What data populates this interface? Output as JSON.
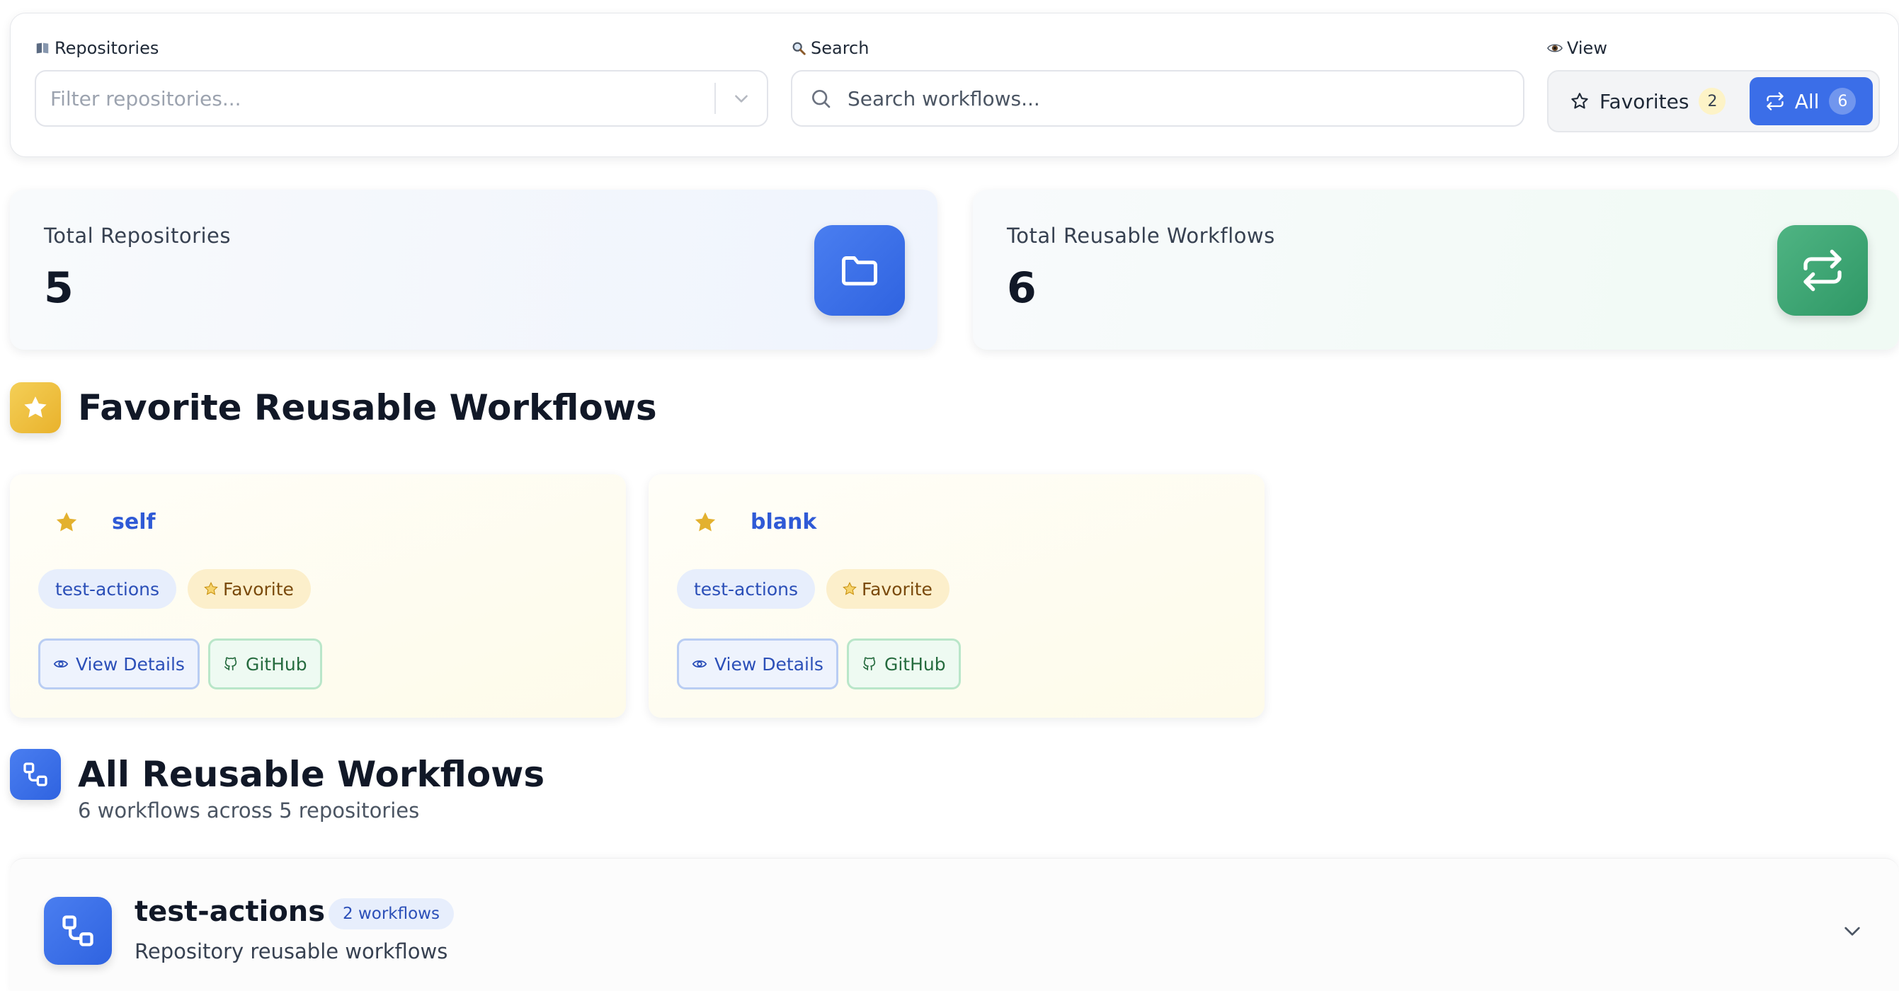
{
  "filters": {
    "repositories": {
      "label": "Repositories",
      "placeholder": "Filter repositories..."
    },
    "search": {
      "label": "Search",
      "placeholder": "Search workflows..."
    },
    "view": {
      "label": "View",
      "favorites_label": "Favorites",
      "favorites_count": "2",
      "all_label": "All",
      "all_count": "6",
      "selected": "All"
    }
  },
  "stats": {
    "repositories": {
      "label": "Total Repositories",
      "value": "5",
      "icon": "folder-icon"
    },
    "workflows": {
      "label": "Total Reusable Workflows",
      "value": "6",
      "icon": "repeat-icon"
    }
  },
  "favorites_section": {
    "title": "Favorite Reusable Workflows",
    "icon": "star-icon",
    "cards": [
      {
        "name": "self",
        "repo": "test-actions",
        "badge": "Favorite",
        "details_label": "View Details",
        "github_label": "GitHub"
      },
      {
        "name": "blank",
        "repo": "test-actions",
        "badge": "Favorite",
        "details_label": "View Details",
        "github_label": "GitHub"
      }
    ]
  },
  "all_section": {
    "title": "All Reusable Workflows",
    "subtitle": "6 workflows across 5 repositories",
    "icon": "workflow-icon",
    "repos": [
      {
        "name": "test-actions",
        "count_label": "2 workflows",
        "description": "Repository reusable workflows",
        "expanded": false
      }
    ]
  },
  "colors": {
    "accent_blue": "#3b6ee8",
    "accent_green": "#2f9866",
    "accent_gold": "#e9b22c",
    "link_blue": "#2f5ad6"
  }
}
